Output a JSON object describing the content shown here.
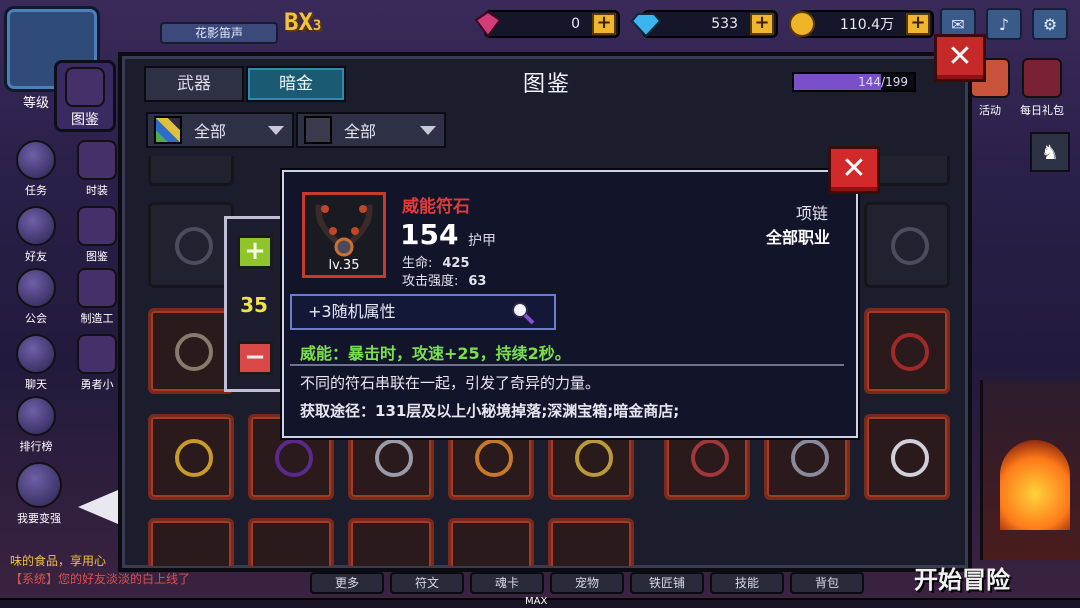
{
  "top_bar": {
    "player_name": "花影笛声",
    "level_badge": "BX",
    "level_badge_sub": "3",
    "currencies": [
      {
        "icon": "heart-gem-icon",
        "value": "0",
        "color": "#d23c78"
      },
      {
        "icon": "diamond-icon",
        "value": "533",
        "color": "#3cb4f0"
      },
      {
        "icon": "gold-coin-icon",
        "value": "110.4万",
        "color": "#f0b428"
      }
    ],
    "plus_label": "+",
    "icons": [
      "mail-icon",
      "speaker-icon",
      "settings-icon"
    ]
  },
  "left_sidebar": {
    "col1": [
      {
        "label": "等级",
        "icon": "portrait-icon"
      },
      {
        "label": "任务",
        "icon": "quest-scroll-icon"
      },
      {
        "label": "好友",
        "icon": "friends-icon"
      },
      {
        "label": "公会",
        "icon": "guild-icon"
      },
      {
        "label": "聊天",
        "icon": "chat-bubble-icon"
      },
      {
        "label": "排行榜",
        "icon": "trophy-icon"
      },
      {
        "label": "我要变强",
        "icon": "power-up-icon"
      }
    ],
    "col2": [
      {
        "label": "图鉴",
        "icon": "codex-icon"
      },
      {
        "label": "时装",
        "icon": "fashion-icon"
      },
      {
        "label": "图鉴",
        "icon": "codex-icon"
      },
      {
        "label": "制造工",
        "icon": "craft-icon"
      },
      {
        "label": "勇者小",
        "icon": "hero-icon"
      }
    ]
  },
  "window": {
    "title": "图鉴",
    "tabs": [
      {
        "label": "武器",
        "active": false
      },
      {
        "label": "暗金",
        "active": true
      }
    ],
    "progress": {
      "text": "144/199",
      "current": 144,
      "total": 199
    },
    "filters": [
      {
        "label": "全部",
        "icon": "grid-icon"
      },
      {
        "label": "全部",
        "icon": "skull-icon"
      }
    ],
    "close_label": "✕"
  },
  "quantity": {
    "value": "35",
    "plus": "+",
    "minus": "−"
  },
  "tooltip": {
    "close_label": "✕",
    "item_name": "威能符石",
    "item_level": "lv.35",
    "score": "154",
    "score_label": "护甲",
    "stats": [
      {
        "label": "生命:",
        "value": "425"
      },
      {
        "label": "攻击强度:",
        "value": "63"
      }
    ],
    "slot_type": "项链",
    "class_req": "全部职业",
    "random_attr": "+3随机属性",
    "effect": "威能：暴击时，攻速+25，持续2秒。",
    "description": "不同的符石串联在一起，引发了奇异的力量。",
    "source": "获取途径：131层及以上小秘境掉落;深渊宝箱;暗金商店;"
  },
  "right_side": [
    {
      "label": "活动",
      "icon": "event-icon"
    },
    {
      "label": "每日礼包",
      "icon": "gift-icon"
    }
  ],
  "bottom": {
    "chat": [
      {
        "text": "味的食品，享用心",
        "color": "#f0c040"
      },
      {
        "text": "【系统】您的好友淡淡的白上线了",
        "color": "#e05050"
      }
    ],
    "tabs": [
      "更多",
      "符文",
      "魂卡",
      "宠物",
      "铁匠铺",
      "技能",
      "背包"
    ],
    "start_label": "开始冒险",
    "max_label": "MAX"
  }
}
